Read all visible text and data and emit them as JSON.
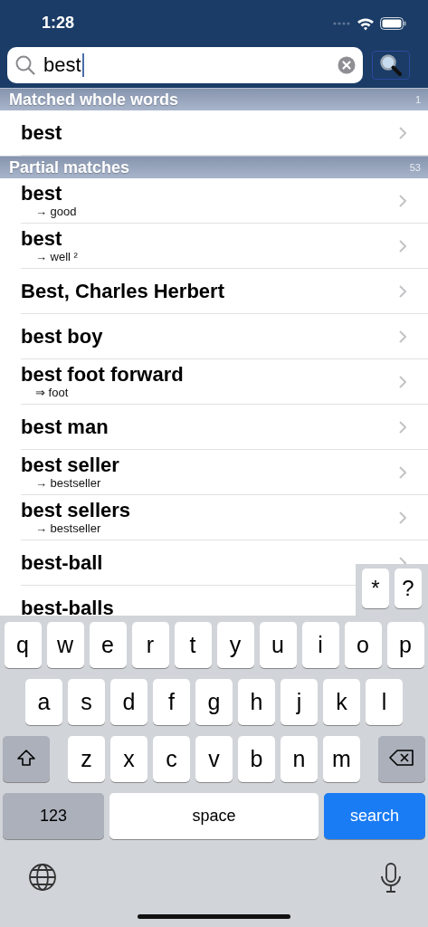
{
  "status_bar": {
    "time": "1:28"
  },
  "search": {
    "value": "best"
  },
  "sections": [
    {
      "title": "Matched whole words",
      "count": "1",
      "rows": [
        {
          "word": "best"
        }
      ]
    },
    {
      "title": "Partial matches",
      "count": "53",
      "rows": [
        {
          "word": "best",
          "note": "→ good"
        },
        {
          "word": "best",
          "note": "→ well ²"
        },
        {
          "word": "Best, Charles Herbert"
        },
        {
          "word": "best boy"
        },
        {
          "word": "best foot forward",
          "note": "⇒ foot"
        },
        {
          "word": "best man"
        },
        {
          "word": "best seller",
          "note": "→ bestseller"
        },
        {
          "word": "best sellers",
          "note": "→ bestseller"
        },
        {
          "word": "best-ball"
        },
        {
          "word": "best-balls"
        }
      ]
    }
  ],
  "accessory_keys": [
    "*",
    "?"
  ],
  "keyboard": {
    "rows": [
      [
        "q",
        "w",
        "e",
        "r",
        "t",
        "y",
        "u",
        "i",
        "o",
        "p"
      ],
      [
        "a",
        "s",
        "d",
        "f",
        "g",
        "h",
        "j",
        "k",
        "l"
      ],
      [
        "z",
        "x",
        "c",
        "v",
        "b",
        "n",
        "m"
      ]
    ],
    "numbers_key": "123",
    "space_key": "space",
    "action_key": "search"
  }
}
